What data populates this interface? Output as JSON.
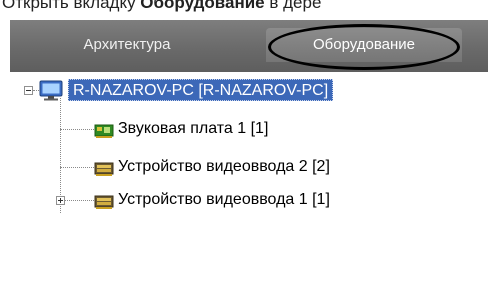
{
  "caption": {
    "prefix": "Открыть вкладку ",
    "bold": "Оборудование",
    "suffix": " в дере"
  },
  "tabs": [
    {
      "label": "Архитектура",
      "active": false
    },
    {
      "label": "Оборудование",
      "active": true
    }
  ],
  "tree": {
    "root": {
      "label": "R-NAZAROV-PC [R-NAZAROV-PC]",
      "expanded": true,
      "icon": "computer-icon",
      "selected": true
    },
    "children": [
      {
        "label": "Звуковая плата 1 [1]",
        "icon": "sound-card-icon",
        "expandable": false
      },
      {
        "label": "Устройство видеоввода 2 [2]",
        "icon": "video-capture-board-icon",
        "expandable": false
      },
      {
        "label": "Устройство видеоввода 1 [1]",
        "icon": "video-capture-board-icon",
        "expandable": true
      }
    ]
  },
  "colors": {
    "tabbar": "#6e6e6e",
    "selection": "#3c68b8",
    "sound_card": "#2f8a22",
    "video_board": "#5a4a2a"
  }
}
